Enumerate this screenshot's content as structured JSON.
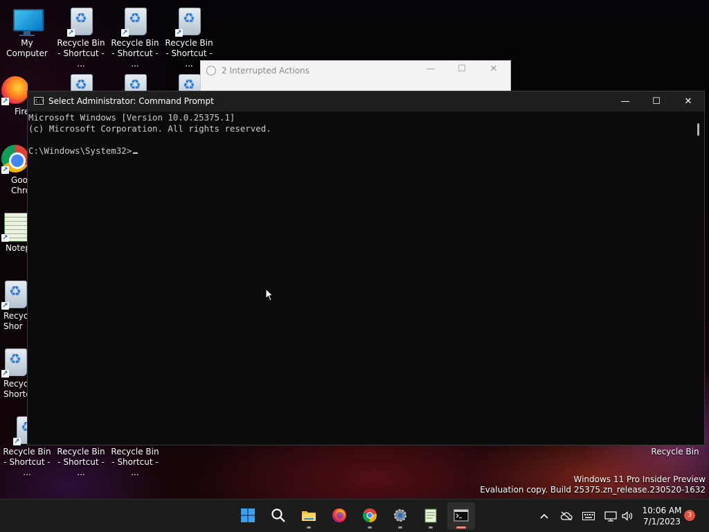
{
  "desktop": {
    "icons": [
      {
        "label": "My Computer"
      },
      {
        "label": "Recycle Bin - Shortcut - ..."
      },
      {
        "label": "Recycle Bin - Shortcut - ..."
      },
      {
        "label": "Recycle Bin - Shortcut - ..."
      },
      {
        "label": "Fire"
      },
      {
        "label": "Goo Chro"
      },
      {
        "label": "Notep"
      },
      {
        "label": "Recycl Shor"
      },
      {
        "label": "Recycl Shortc"
      },
      {
        "label": "Recycle Bin - Shortcut - ..."
      },
      {
        "label": "Recycle Bin - Shortcut - ..."
      },
      {
        "label": "Recycle Bin - Shortcut - ..."
      },
      {
        "label": "Recycle Bin"
      }
    ]
  },
  "bg_dialog": {
    "title": "2 Interrupted Actions"
  },
  "cmd": {
    "title": "Select Administrator:  Command Prompt",
    "lines": [
      "Microsoft Windows [Version 10.0.25375.1]",
      "(c) Microsoft Corporation. All rights reserved.",
      "",
      "C:\\Windows\\System32>"
    ],
    "minimize": "—",
    "maximize": "☐",
    "close": "✕"
  },
  "watermark": {
    "line1": "Windows 11 Pro Insider Preview",
    "line2": "Evaluation copy. Build 25375.zn_release.230520-1632"
  },
  "taskbar": {
    "apps": [
      {
        "name": "start"
      },
      {
        "name": "search"
      },
      {
        "name": "file-explorer"
      },
      {
        "name": "firefox"
      },
      {
        "name": "chrome"
      },
      {
        "name": "settings"
      },
      {
        "name": "notepad"
      },
      {
        "name": "command-prompt"
      }
    ],
    "time": "10:06 AM",
    "date": "7/1/2023",
    "notification_count": "3"
  }
}
